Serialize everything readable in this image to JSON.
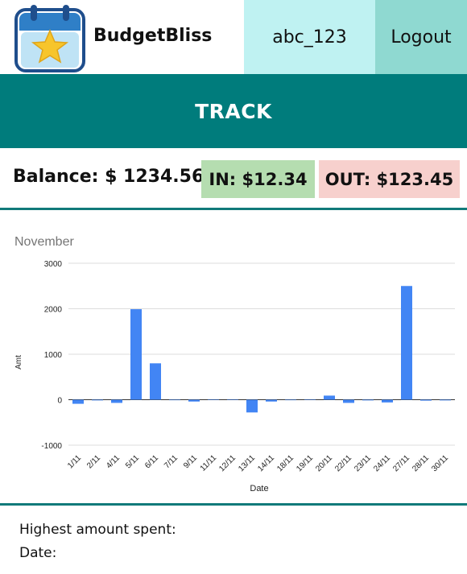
{
  "app": {
    "name": "BudgetBliss"
  },
  "header": {
    "username": "abc_123",
    "logout_label": "Logout"
  },
  "banner": {
    "title": "TRACK"
  },
  "summary": {
    "balance": "Balance: $ 1234.56",
    "in": "IN: $12.34",
    "out": "OUT: $123.45"
  },
  "colors": {
    "brand_teal": "#007c7c",
    "user_bg": "#bff2f2",
    "logout_bg": "#8fd9d1",
    "in_bg": "#b5ddb0",
    "out_bg": "#f7d0cd",
    "bar": "#4285f4"
  },
  "icons": {
    "logo": "calendar-star-icon"
  },
  "chart_data": {
    "type": "bar",
    "title": "November",
    "xlabel": "Date",
    "ylabel": "Amt",
    "ylim": [
      -1000,
      3000
    ],
    "yticks": [
      3000,
      2000,
      1000,
      0,
      -1000
    ],
    "grid": true,
    "categories": [
      "1/11",
      "2/11",
      "4/11",
      "5/11",
      "6/11",
      "7/11",
      "9/11",
      "11/11",
      "12/11",
      "13/11",
      "14/11",
      "18/11",
      "19/11",
      "20/11",
      "22/11",
      "23/11",
      "24/11",
      "27/11",
      "28/11",
      "30/11"
    ],
    "values": [
      -90,
      -15,
      -70,
      1990,
      800,
      -10,
      -40,
      0,
      0,
      -280,
      -40,
      -10,
      0,
      90,
      -70,
      -15,
      -60,
      2500,
      -20,
      -15
    ]
  },
  "footer": {
    "highest_label": "Highest amount spent:",
    "date_label": "Date:"
  }
}
